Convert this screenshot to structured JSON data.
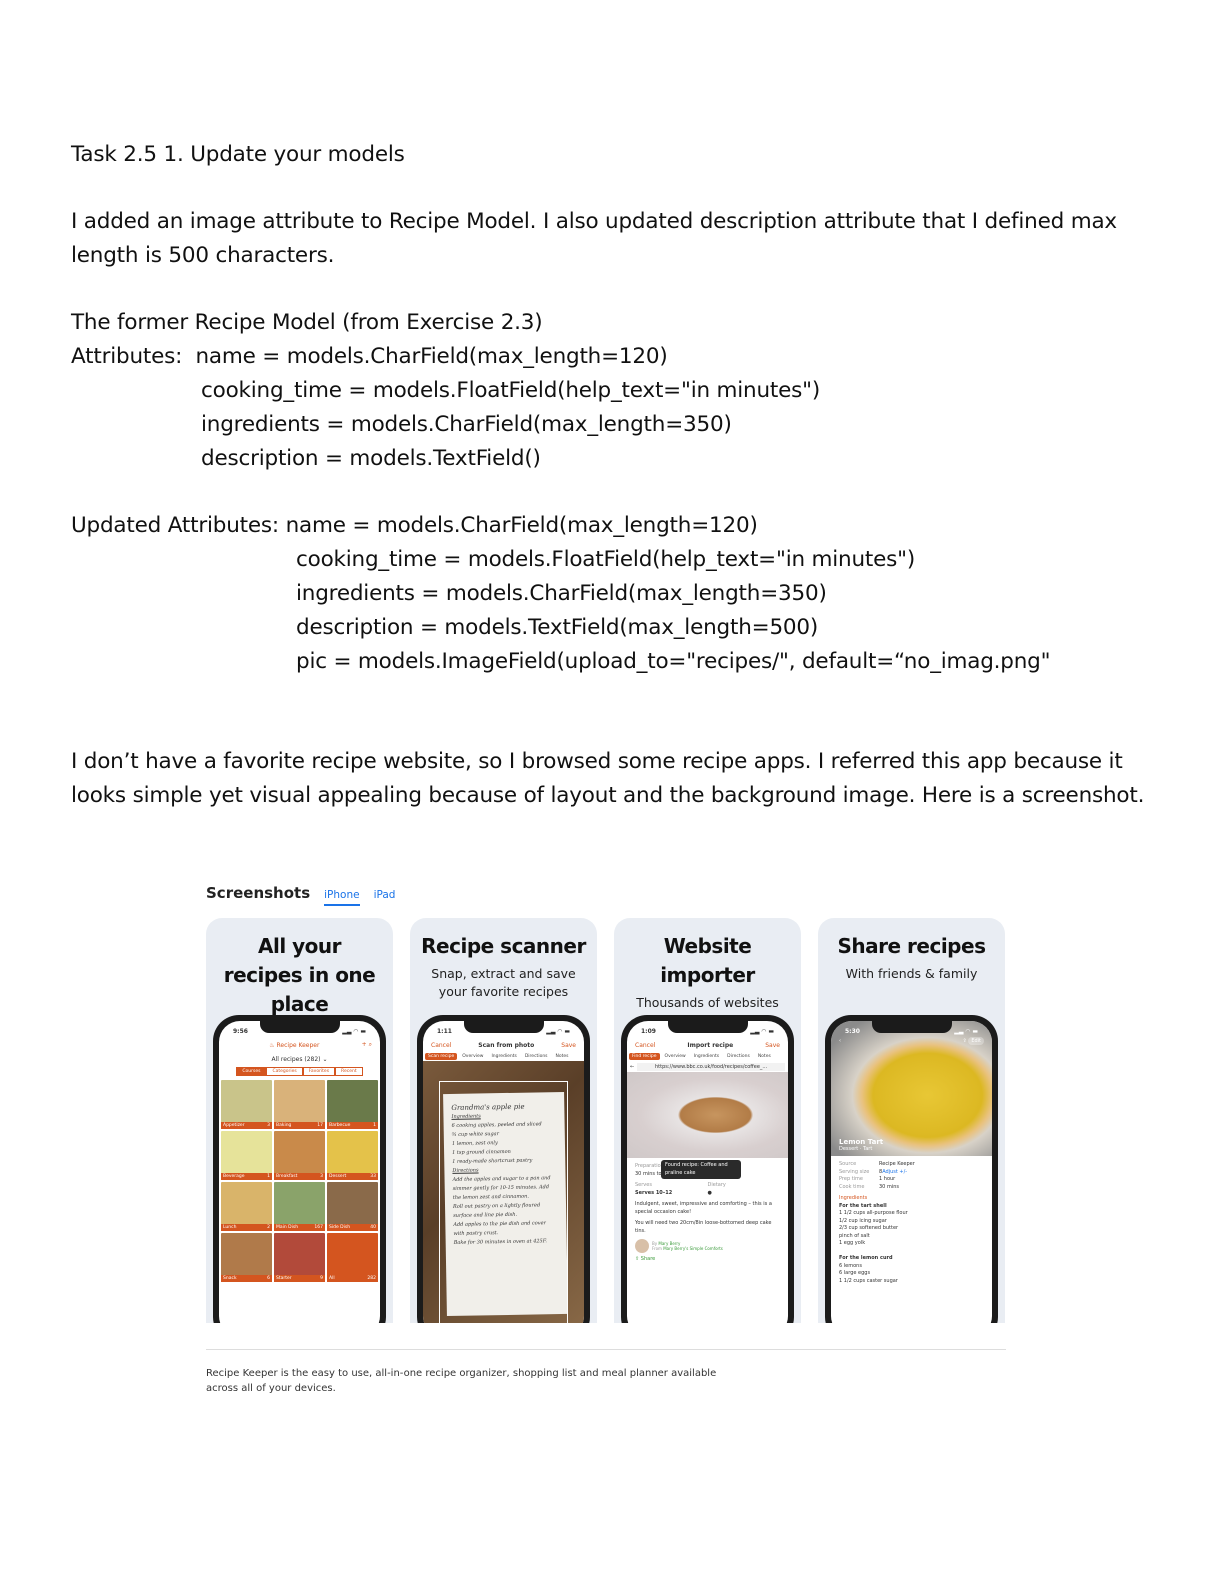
{
  "doc": {
    "task_title": "Task 2.5 1. Update your models",
    "intro": "I added an image attribute to Recipe Model. I also updated description attribute that I defined max length is 500 characters.",
    "former_heading": "The former Recipe Model (from Exercise 2.3)",
    "former_label": "Attributes:",
    "former_attrs": [
      "name = models.CharField(max_length=120)",
      "cooking_time = models.FloatField(help_text=\"in minutes\")",
      "ingredients = models.CharField(max_length=350)",
      "description = models.TextField()"
    ],
    "updated_label": "Updated Attributes:",
    "updated_attrs": [
      "name = models.CharField(max_length=120)",
      "cooking_time = models.FloatField(help_text=\"in minutes\")",
      "ingredients = models.CharField(max_length=350)",
      "description = models.TextField(max_length=500)",
      "pic = models.ImageField(upload_to=\"recipes/\", default=“no_imag.png\""
    ],
    "closing": "I don’t have a favorite recipe website, so I browsed some recipe apps. I referred this app because it looks simple yet visual appealing because of layout and the background image. Here is a screenshot."
  },
  "store": {
    "title": "Screenshots",
    "tabs": [
      {
        "label": "iPhone",
        "active": true
      },
      {
        "label": "iPad",
        "active": false
      }
    ],
    "accent": "#d4551f",
    "cards": [
      {
        "title": "All your recipes in one place",
        "time": "9:56",
        "app_name": "Recipe Keeper",
        "filter": "All recipes (282)",
        "segments": [
          "Courses",
          "Categories",
          "Favorites",
          "Recent"
        ],
        "tiles": [
          {
            "name": "Appetizer",
            "count": "3",
            "color": "#c9c48a"
          },
          {
            "name": "Baking",
            "count": "17",
            "color": "#d9b27a"
          },
          {
            "name": "Barbecue",
            "count": "1",
            "color": "#6a7a4a"
          },
          {
            "name": "Beverage",
            "count": "1",
            "color": "#e6e39a"
          },
          {
            "name": "Breakfast",
            "count": "3",
            "color": "#c98a4a"
          },
          {
            "name": "Dessert",
            "count": "33",
            "color": "#e4c24a"
          },
          {
            "name": "Lunch",
            "count": "2",
            "color": "#d9b46a"
          },
          {
            "name": "Main Dish",
            "count": "167",
            "color": "#8aa36a"
          },
          {
            "name": "Side Dish",
            "count": "40",
            "color": "#8a6a4a"
          },
          {
            "name": "Snack",
            "count": "6",
            "color": "#b07a4a"
          },
          {
            "name": "Starter",
            "count": "9",
            "color": "#b24a3a"
          },
          {
            "name": "All",
            "count": "282",
            "color": "#d4551f"
          }
        ]
      },
      {
        "title": "Recipe scanner",
        "subtitle": "Snap, extract and save your favorite recipes",
        "time": "1:11",
        "cancel": "Cancel",
        "screen_title": "Scan from photo",
        "save": "Save",
        "tabs": [
          "Scan recipe",
          "Overview",
          "Ingredients",
          "Directions",
          "Notes"
        ],
        "paper_lines": [
          "Grandma's apple pie",
          "Ingredients",
          "6 cooking apples, peeled and sliced",
          "¾ cup white sugar",
          "1 lemon, zest only",
          "1 tsp ground cinnamon",
          "1 ready-made shortcrust pastry",
          "Directions",
          "Add the apples and sugar to a pan and simmer gently for 10-15 minutes. Add the lemon zest and cinnamon.",
          "Roll out pastry on a lightly floured surface and line pie dish.",
          "Add apples to the pie dish and cover with pastry crust.",
          "Bake for 30 minutes in oven at 425F."
        ]
      },
      {
        "title": "Website importer",
        "subtitle": "Thousands of websites supported",
        "time": "1:09",
        "cancel": "Cancel",
        "screen_title": "Import recipe",
        "save": "Save",
        "tabs": [
          "Find recipe",
          "Overview",
          "Ingredients",
          "Directions",
          "Notes"
        ],
        "url": "https://www.bbc.co.uk/food/recipes/coffee_...",
        "prep_label": "Preparation",
        "prep_value": "30 mins to 1 hour",
        "toast": "Found recipe: Coffee and praline cake",
        "serves_label": "Serves",
        "serves_value": "Serves 10–12",
        "dietary_label": "Dietary",
        "desc1": "Indulgent, sweet, impressive and comforting – this is a special occasion cake!",
        "desc2": "You will need two 20cm/8in loose-bottomed deep cake tins.",
        "by_label": "By",
        "author": "Mary Berry",
        "from_label": "From",
        "source": "Mary Berry's Simple Comforts",
        "share": "Share"
      },
      {
        "title": "Share recipes",
        "subtitle": "With friends & family",
        "time": "5:30",
        "edit": "Edit",
        "recipe_name": "Lemon Tart",
        "recipe_cat": "Dessert · Tart",
        "details": [
          {
            "k": "Source",
            "v": "Recipe Keeper"
          },
          {
            "k": "Serving size",
            "v": "8",
            "link": "Adjust +/-"
          },
          {
            "k": "Prep time",
            "v": "1 hour"
          },
          {
            "k": "Cook time",
            "v": "30 mins"
          }
        ],
        "ingredients_label": "Ingredients",
        "ingredients": [
          "For the tart shell",
          "1 1/2 cups all-purpose flour",
          "1/2 cup icing sugar",
          "2/3 cup softened butter",
          "pinch of salt",
          "1 egg yolk",
          "",
          "For the lemon curd",
          "6 lemons",
          "6 large eggs",
          "1 1/2 cups caster sugar"
        ]
      }
    ],
    "caption": "Recipe Keeper is the easy to use, all-in-one recipe organizer, shopping list and meal planner available across all of your devices."
  }
}
